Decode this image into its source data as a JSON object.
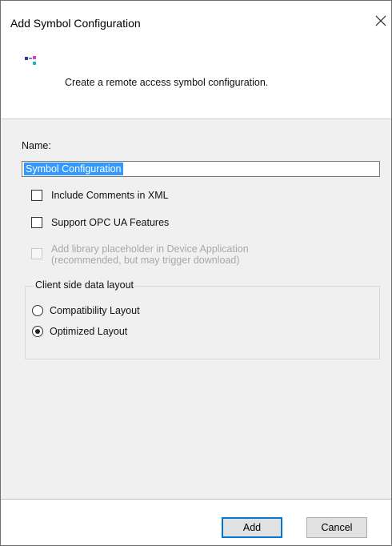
{
  "window": {
    "title": "Add Symbol Configuration",
    "close_icon": "close-icon"
  },
  "header": {
    "icon": "symbol-configuration-icon",
    "description": "Create a remote access symbol configuration."
  },
  "form": {
    "name_label": "Name:",
    "name_value": "Symbol Configuration",
    "checkboxes": [
      {
        "label": "Include Comments in XML",
        "checked": false,
        "enabled": true
      },
      {
        "label": "Support OPC UA Features",
        "checked": false,
        "enabled": true
      },
      {
        "label_line1": "Add library placeholder in Device Application",
        "label_line2": "(recommended, but may trigger download)",
        "checked": false,
        "enabled": false
      }
    ],
    "layout_group": {
      "label": "Client side data layout",
      "options": [
        {
          "label": "Compatibility Layout",
          "selected": false
        },
        {
          "label": "Optimized Layout",
          "selected": true
        }
      ]
    }
  },
  "footer": {
    "add_label": "Add",
    "cancel_label": "Cancel"
  },
  "colors": {
    "selection": "#3399ff",
    "content_bg": "#f0f0f0",
    "disabled_text": "#a8a8a8"
  }
}
